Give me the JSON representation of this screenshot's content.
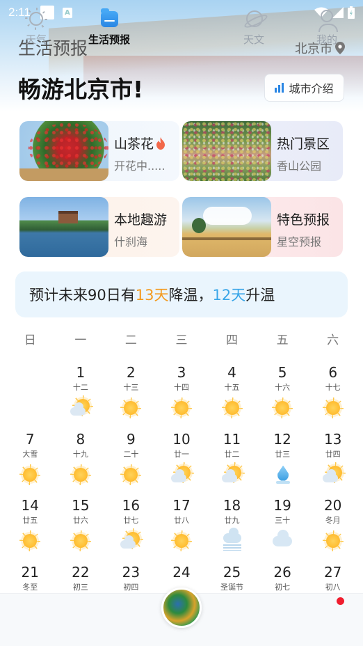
{
  "status_bar": {
    "time": "2:11",
    "icon_a": "A"
  },
  "header": {
    "title": "生活预报",
    "city": "北京市",
    "headline": "畅游北京市!",
    "intro_button": "城市介绍"
  },
  "cards": [
    {
      "title": "山茶花",
      "subtitle": "开花中.....",
      "image": "camellia-photo",
      "badge_icon": "flame-icon"
    },
    {
      "title": "热门景区",
      "subtitle": "香山公园",
      "image": "xiangshan-park-photo"
    },
    {
      "title": "本地趣游",
      "subtitle": "什刹海",
      "image": "shichahai-photo"
    },
    {
      "title": "特色预报",
      "subtitle": "星空预报",
      "image": "countryside-painting"
    }
  ],
  "forecast": {
    "prefix": "预计未来90日有 ",
    "cool_days": "13天",
    "cool_label": "降温，",
    "warm_days": "12天",
    "warm_label": "升温",
    "colors": {
      "cool": "#f39a1f",
      "warm": "#3aa6e8"
    }
  },
  "weekdays": [
    "日",
    "一",
    "二",
    "三",
    "四",
    "五",
    "六"
  ],
  "calendar": [
    {
      "day": "1",
      "lunar": "十二",
      "weather": "partly-cloudy"
    },
    {
      "day": "2",
      "lunar": "十三",
      "weather": "sunny"
    },
    {
      "day": "3",
      "lunar": "十四",
      "weather": "sunny"
    },
    {
      "day": "4",
      "lunar": "十五",
      "weather": "sunny"
    },
    {
      "day": "5",
      "lunar": "十六",
      "weather": "sunny"
    },
    {
      "day": "6",
      "lunar": "十七",
      "weather": "sunny"
    },
    {
      "day": "7",
      "lunar": "大雪",
      "weather": "sunny"
    },
    {
      "day": "8",
      "lunar": "十九",
      "weather": "sunny"
    },
    {
      "day": "9",
      "lunar": "二十",
      "weather": "sunny"
    },
    {
      "day": "10",
      "lunar": "廿一",
      "weather": "partly-cloudy"
    },
    {
      "day": "11",
      "lunar": "廿二",
      "weather": "partly-cloudy"
    },
    {
      "day": "12",
      "lunar": "廿三",
      "weather": "rain"
    },
    {
      "day": "13",
      "lunar": "廿四",
      "weather": "partly-cloudy"
    },
    {
      "day": "14",
      "lunar": "廿五",
      "weather": "sunny"
    },
    {
      "day": "15",
      "lunar": "廿六",
      "weather": "sunny"
    },
    {
      "day": "16",
      "lunar": "廿七",
      "weather": "partly-cloudy"
    },
    {
      "day": "17",
      "lunar": "廿八",
      "weather": "sunny"
    },
    {
      "day": "18",
      "lunar": "廿九",
      "weather": "fog"
    },
    {
      "day": "19",
      "lunar": "三十",
      "weather": "cloudy"
    },
    {
      "day": "20",
      "lunar": "冬月",
      "weather": "sunny"
    },
    {
      "day": "21",
      "lunar": "冬至",
      "weather": ""
    },
    {
      "day": "22",
      "lunar": "初三",
      "weather": ""
    },
    {
      "day": "23",
      "lunar": "初四",
      "weather": ""
    },
    {
      "day": "24",
      "lunar": "",
      "weather": ""
    },
    {
      "day": "25",
      "lunar": "圣诞节",
      "weather": ""
    },
    {
      "day": "26",
      "lunar": "初七",
      "weather": ""
    },
    {
      "day": "27",
      "lunar": "初八",
      "weather": ""
    }
  ],
  "calendar_start_weekday": 1,
  "bottom_nav": [
    {
      "label": "天气",
      "icon": "sun-outline-icon",
      "active": false
    },
    {
      "label": "生活预报",
      "icon": "life-forecast-icon",
      "active": true
    },
    {
      "label": "",
      "icon": "radar-map-icon",
      "active": false
    },
    {
      "label": "天文",
      "icon": "planet-icon",
      "active": false
    },
    {
      "label": "我的",
      "icon": "user-icon",
      "active": false,
      "badge": true
    }
  ],
  "colors": {
    "accent": "#2a86e4",
    "badge": "#f01d2e"
  }
}
